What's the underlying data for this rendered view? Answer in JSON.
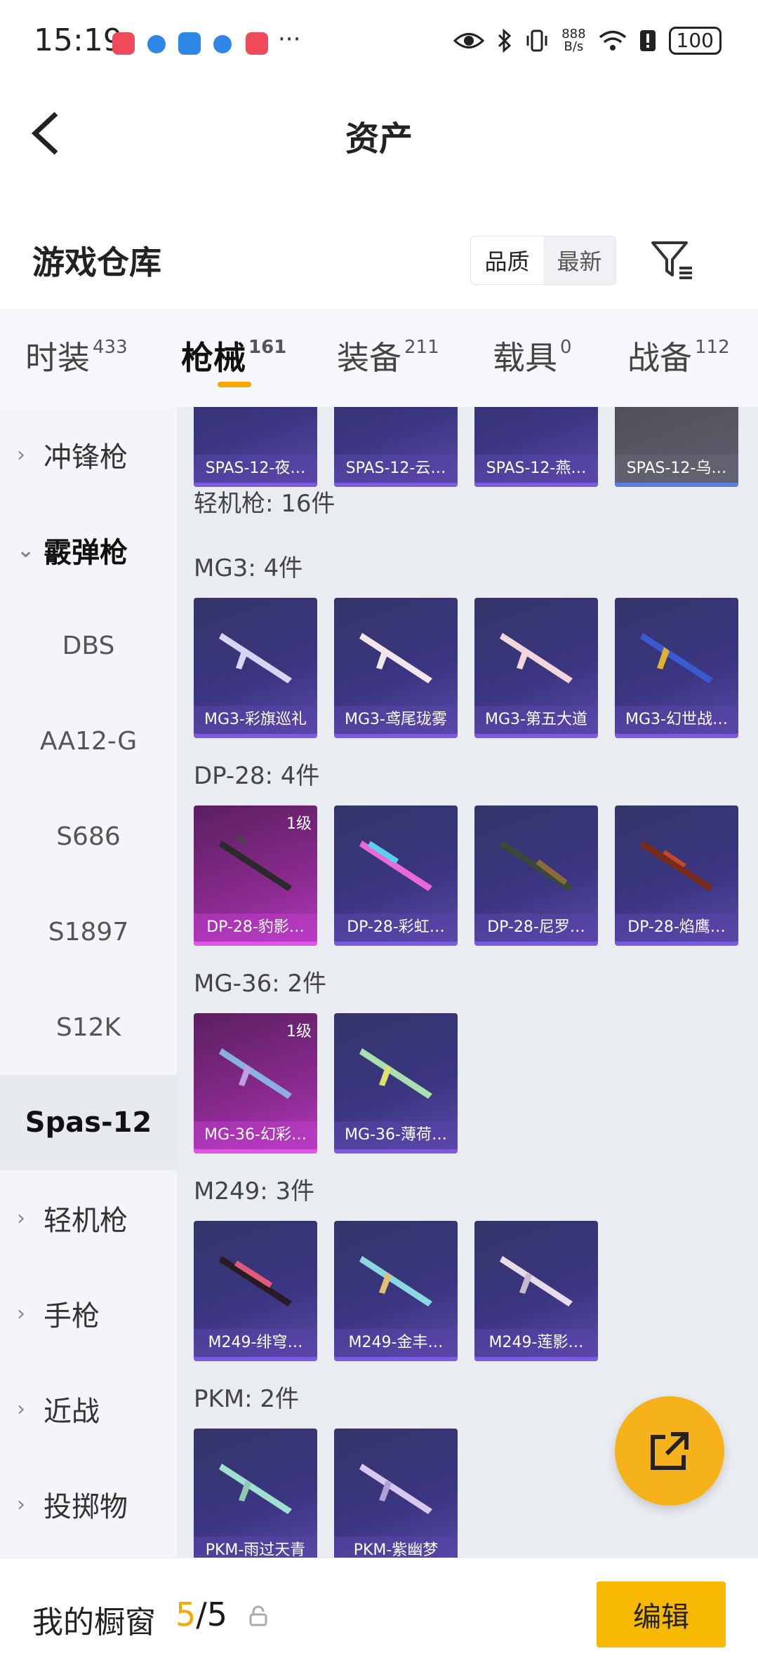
{
  "status_bar": {
    "time": "15:19",
    "more": "···",
    "net_speed_top": "888",
    "net_speed_bottom": "B/s",
    "battery": "100"
  },
  "header": {
    "title": "资产"
  },
  "warehouse": {
    "title": "游戏仓库",
    "sort_options": [
      "品质",
      "最新"
    ]
  },
  "category_tabs": [
    {
      "label": "时装",
      "count": "433"
    },
    {
      "label": "枪械",
      "count": "161"
    },
    {
      "label": "装备",
      "count": "211"
    },
    {
      "label": "载具",
      "count": "0"
    },
    {
      "label": "战备",
      "count": "112"
    }
  ],
  "sidebar": [
    {
      "label": "冲锋枪"
    },
    {
      "label": "霰弹枪"
    },
    {
      "label": "DBS"
    },
    {
      "label": "AA12-G"
    },
    {
      "label": "S686"
    },
    {
      "label": "S1897"
    },
    {
      "label": "S12K"
    },
    {
      "label": "Spas-12"
    },
    {
      "label": "轻机枪"
    },
    {
      "label": "手枪"
    },
    {
      "label": "近战"
    },
    {
      "label": "投掷物"
    }
  ],
  "content": {
    "top_cards": [
      "SPAS-12-夜…",
      "SPAS-12-云…",
      "SPAS-12-燕…",
      "SPAS-12-乌…"
    ],
    "lmg_total": "轻机枪: 16件",
    "groups": [
      {
        "title": "MG3: 4件",
        "items": [
          "MG3-彩旗巡礼",
          "MG3-鸢尾珑雾",
          "MG3-第五大道",
          "MG3-幻世战…"
        ]
      },
      {
        "title": "DP-28: 4件",
        "items": [
          "DP-28-豹影…",
          "DP-28-彩虹…",
          "DP-28-尼罗…",
          "DP-28-焰鹰…"
        ],
        "level": "1级"
      },
      {
        "title": "MG-36: 2件",
        "items": [
          "MG-36-幻彩…",
          "MG-36-薄荷…"
        ],
        "level": "1级"
      },
      {
        "title": "M249: 3件",
        "items": [
          "M249-绯穹…",
          "M249-金丰…",
          "M249-莲影…"
        ]
      },
      {
        "title": "PKM: 2件",
        "items": [
          "PKM-雨过天青",
          "PKM-紫幽梦"
        ]
      }
    ]
  },
  "bottom": {
    "label": "我的橱窗",
    "current": "5",
    "total": "/5",
    "edit": "编辑"
  }
}
